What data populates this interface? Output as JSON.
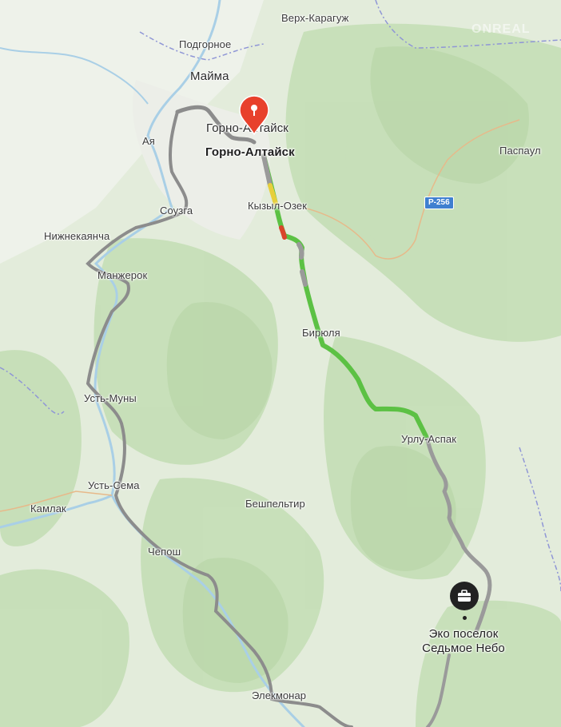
{
  "map": {
    "origin_label": "Горно-Алтайск",
    "destination_label_line1": "Эко поселок",
    "destination_label_line2": "Седьмое Небо",
    "road_badge": "Р-256",
    "watermark": "ONREAL",
    "places": [
      {
        "id": "verkh-karaguzh",
        "name": "Верх-Карагуж"
      },
      {
        "id": "podgornoe",
        "name": "Подгорное"
      },
      {
        "id": "mayma",
        "name": "Майма"
      },
      {
        "id": "gorno-altaysk",
        "name": "Горно-Алтайск"
      },
      {
        "id": "aya",
        "name": "Ая"
      },
      {
        "id": "paspaul",
        "name": "Паспаул"
      },
      {
        "id": "souzga",
        "name": "Соузга"
      },
      {
        "id": "kyzyl-ozek",
        "name": "Кызыл-Озек"
      },
      {
        "id": "nizhnekayancha",
        "name": "Нижнекаянча"
      },
      {
        "id": "manzherok",
        "name": "Манжерок"
      },
      {
        "id": "biryulya",
        "name": "Бирюля"
      },
      {
        "id": "ust-muny",
        "name": "Усть-Муны"
      },
      {
        "id": "urlu-aspak",
        "name": "Урлу-Аспак"
      },
      {
        "id": "ust-sema",
        "name": "Усть-Сема"
      },
      {
        "id": "beshpeltir",
        "name": "Бешпельтир"
      },
      {
        "id": "kamlak",
        "name": "Камлак"
      },
      {
        "id": "chemal",
        "name": "Чепош"
      },
      {
        "id": "elekmonar",
        "name": "Элекмонар"
      }
    ]
  },
  "colors": {
    "background_terrain": "#dfe9d6",
    "forest": "#c4ddb6",
    "route_green": "#5cc144",
    "route_yellow": "#e7cf3c",
    "route_red": "#d9452b",
    "route_gray": "#9a9a9a",
    "pin_red": "#e8412c",
    "marker_dark": "#222222",
    "river": "#a9cfe6",
    "border": "#8f96d6"
  },
  "icons": {
    "origin_pin": "map-pin-icon",
    "destination_marker": "briefcase-icon"
  }
}
